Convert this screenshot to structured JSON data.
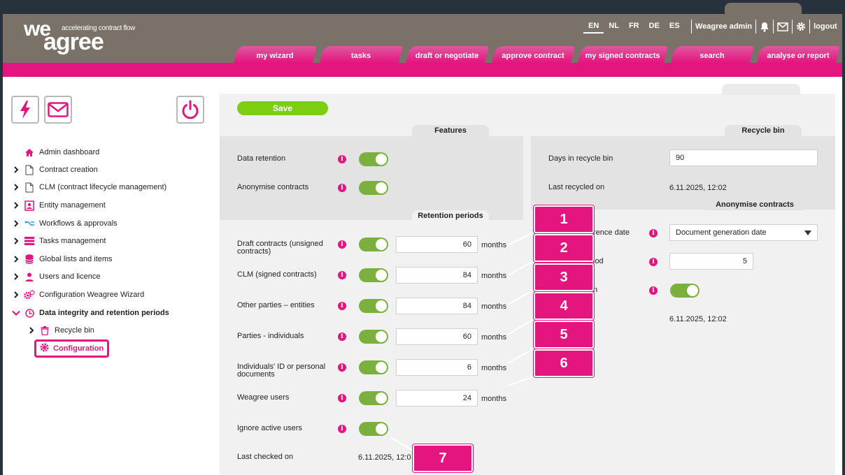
{
  "header": {
    "logo_top": "we",
    "logo_bottom": "agree",
    "tagline": "accelerating contract flow",
    "languages": [
      "EN",
      "NL",
      "FR",
      "DE",
      "ES"
    ],
    "active_language": "EN",
    "user": "Weagree admin",
    "logout": "logout"
  },
  "nav": {
    "tabs": [
      "my wizard",
      "tasks",
      "draft or negotiate",
      "approve contract",
      "my signed contracts",
      "search",
      "analyse or report"
    ]
  },
  "sidebar": {
    "items": [
      {
        "label": "Admin dashboard",
        "icon": "home-icon"
      },
      {
        "label": "Contract creation",
        "icon": "document-icon"
      },
      {
        "label": "CLM (contract lifecycle management)",
        "icon": "document-icon"
      },
      {
        "label": "Entity management",
        "icon": "entity-icon"
      },
      {
        "label": "Workflows & approvals",
        "icon": "workflow-icon"
      },
      {
        "label": "Tasks management",
        "icon": "tasks-icon"
      },
      {
        "label": "Global lists and items",
        "icon": "database-icon"
      },
      {
        "label": "Users and licence",
        "icon": "user-icon"
      },
      {
        "label": "Configuration Weagree Wizard",
        "icon": "gears-icon"
      },
      {
        "label": "Data integrity and retention periods",
        "icon": "clock-icon"
      }
    ],
    "sub_items": [
      {
        "label": "Recycle bin",
        "icon": "trash-icon"
      },
      {
        "label": "Configuration",
        "icon": "gear-icon"
      }
    ]
  },
  "main": {
    "save_label": "Save",
    "features": {
      "title": "Features",
      "data_retention": "Data retention",
      "anonymise_contracts": "Anonymise contracts"
    },
    "retention": {
      "title": "Retention periods",
      "unit": "months",
      "rows": [
        {
          "label": "Draft contracts (unsigned contracts)",
          "value": "60"
        },
        {
          "label": "CLM (signed contracts)",
          "value": "84"
        },
        {
          "label": "Other parties – entities",
          "value": "84"
        },
        {
          "label": "Parties - individuals",
          "value": "60"
        },
        {
          "label": "Individuals' ID or personal documents",
          "value": "6"
        },
        {
          "label": "Weagree users",
          "value": "24"
        }
      ],
      "ignore_active_users": "Ignore active users",
      "last_checked_label": "Last checked on",
      "last_checked_value": "6.11.2025, 12:0"
    },
    "recycle": {
      "title": "Recycle bin",
      "days_label": "Days in recycle bin",
      "days_value": "90",
      "last_recycled_label": "Last recycled on",
      "last_recycled_value": "6.11.2025, 12:02"
    },
    "anonymise": {
      "title": "Anonymise contracts",
      "reference_label": "rence date",
      "reference_value": "Document generation date",
      "period_label": "iod",
      "period_value": "5",
      "toggle_label": "n",
      "last_value": "6.11.2025, 12:02"
    }
  },
  "callouts": [
    "1",
    "2",
    "3",
    "4",
    "5",
    "6",
    "7"
  ],
  "colors": {
    "brand_pink": "#e4157f",
    "header_grey": "#7a7168",
    "toggle_green": "#7bb03e",
    "save_green": "#7dce13"
  }
}
